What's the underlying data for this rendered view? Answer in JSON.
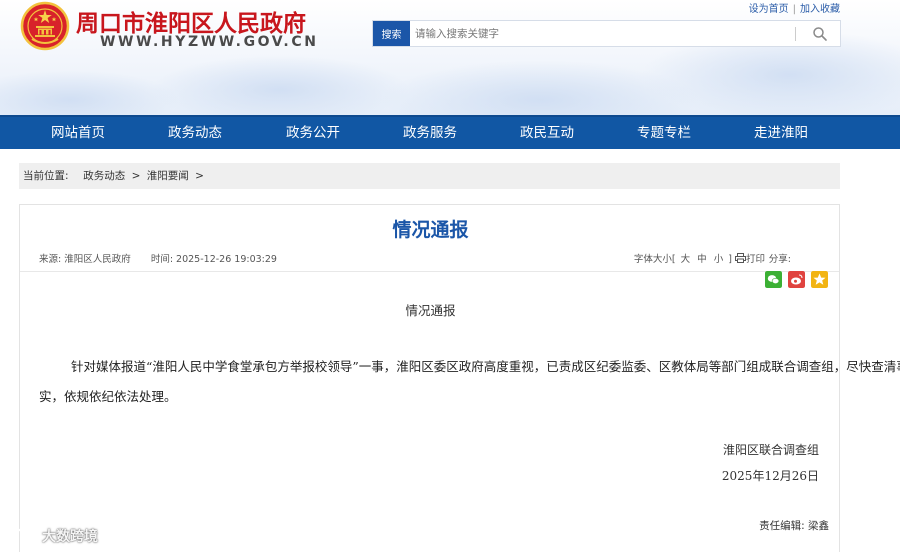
{
  "site": {
    "title": "周口市淮阳区人民政府",
    "url": "WWW.HYZWW.GOV.CN",
    "top_links": [
      "设为首页",
      "加入收藏"
    ]
  },
  "search": {
    "button_label": "搜索",
    "placeholder": "请输入搜索关键字"
  },
  "nav": {
    "items": [
      "网站首页",
      "政务动态",
      "政务公开",
      "政务服务",
      "政民互动",
      "专题专栏",
      "走进淮阳"
    ]
  },
  "breadcrumb": {
    "label": "当前位置:",
    "items": [
      "政务动态",
      "淮阳要闻"
    ],
    "separator": ">"
  },
  "article": {
    "title": "情况通报",
    "source_label": "来源:",
    "source": "淮阳区人民政府",
    "time_label": "时间:",
    "time": "2025-12-26 19:03:29",
    "font_size_label": "字体大小[",
    "font_sizes": [
      "大",
      "中",
      "小"
    ],
    "font_size_close": "]",
    "print_label": "打印",
    "share_label": "分享:",
    "share_icons": [
      "wechat-icon",
      "weibo-icon",
      "qzone-icon"
    ],
    "body_heading": "情况通报",
    "body_text": "针对媒体报道“淮阳人民中学食堂承包方举报校领导”一事，淮阳区委区政府高度重视，已责成区纪委监委、区教体局等部门组成联合调查组，尽快查清事实，依规依纪依法处理。",
    "signature_org": "淮阳区联合调查组",
    "signature_date": "2025年12月26日",
    "editor_label": "责任编辑:",
    "editor": "梁鑫"
  },
  "watermark": {
    "text": "大数跨境"
  },
  "colors": {
    "brand_red": "#c8161d",
    "nav_blue": "#1157a4",
    "title_blue": "#1b56a8",
    "wechat_green": "#3cb034",
    "weibo_red": "#e0433f",
    "qzone_yellow": "#f2b413"
  }
}
